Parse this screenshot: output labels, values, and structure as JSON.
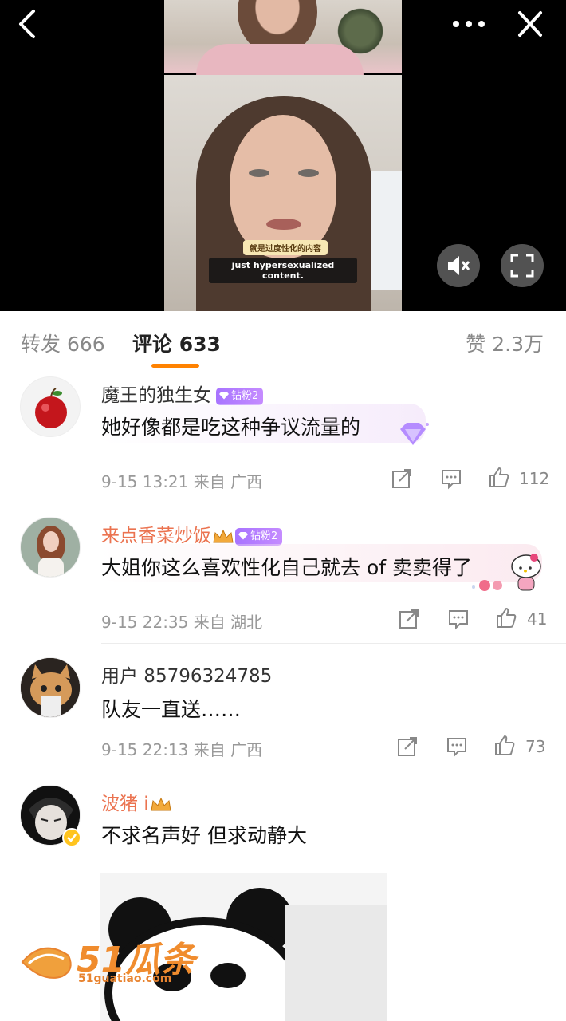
{
  "video": {
    "subtitle_cn": "就是过度性化的内容",
    "subtitle_en": "just hypersexualized content."
  },
  "tabs": {
    "repost": "转发 666",
    "comments": "评论 633",
    "likes": "赞 2.3万",
    "accent_color": "#ff8200"
  },
  "comments": [
    {
      "username": "魔王的独生女",
      "badge": "钻粉2",
      "text": "她好像都是吃这种争议流量的",
      "time": "9-15 13:21",
      "source": "来自 广西",
      "likes": "112"
    },
    {
      "username": "来点香菜炒饭",
      "badge": "钻粉2",
      "text": "大姐你这么喜欢性化自己就去 of 卖卖得了",
      "time": "9-15 22:35",
      "source": "来自 湖北",
      "likes": "41"
    },
    {
      "username": "用户 85796324785",
      "text": "队友一直送……",
      "time": "9-15 22:13",
      "source": "来自 广西",
      "likes": "73"
    },
    {
      "username": "波猪 i",
      "text": "不求名声好 但求动静大"
    }
  ],
  "watermark": {
    "logo": "51瓜条",
    "domain": "51guatiao.com"
  },
  "icons": [
    "back-icon",
    "more-icon",
    "close-icon",
    "mute-icon",
    "fullscreen-icon",
    "share-icon",
    "comment-icon",
    "like-icon",
    "crown-icon",
    "diamond-icon"
  ]
}
